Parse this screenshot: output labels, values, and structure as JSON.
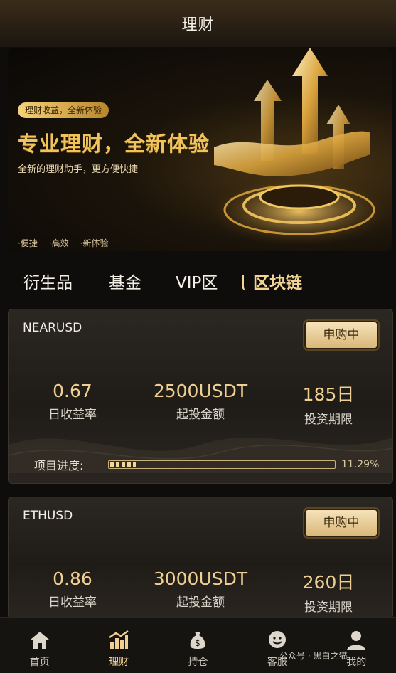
{
  "header": {
    "title": "理财"
  },
  "banner": {
    "pill": "理财收益，全新体验",
    "headline": "专业理财，全新体验",
    "subtitle": "全新的理财助手，更方便快捷",
    "features": [
      "·便捷",
      "·高效",
      "·新体验"
    ]
  },
  "tabs": [
    {
      "label": "衍生品"
    },
    {
      "label": "基金"
    },
    {
      "label": "VIP区"
    },
    {
      "label": "区块链"
    }
  ],
  "active_tab": "区块链",
  "products": [
    {
      "name": "NEARUSD",
      "status": "申购中",
      "rate": "0.67",
      "rate_label": "日收益率",
      "min": "2500USDT",
      "min_label": "起投金额",
      "term": "185日",
      "term_label": "投资期限",
      "progress_label": "项目进度:",
      "progress_text": "11.29%",
      "progress": 0.1129
    },
    {
      "name": "ETHUSD",
      "status": "申购中",
      "rate": "0.86",
      "rate_label": "日收益率",
      "min": "3000USDT",
      "min_label": "起投金额",
      "term": "260日",
      "term_label": "投资期限"
    }
  ],
  "nav": [
    {
      "label": "首页",
      "icon": "home-icon"
    },
    {
      "label": "理财",
      "icon": "chart-icon"
    },
    {
      "label": "持仓",
      "icon": "money-bag-icon"
    },
    {
      "label": "客服",
      "icon": "support-icon"
    },
    {
      "label": "我的",
      "icon": "user-icon"
    }
  ],
  "active_nav": "理财",
  "footer_tag": "公众号 · 黑白之猫",
  "colors": {
    "accent": "#f0cf92",
    "background": "#0e0d0b",
    "button": "#e9d2a0"
  }
}
